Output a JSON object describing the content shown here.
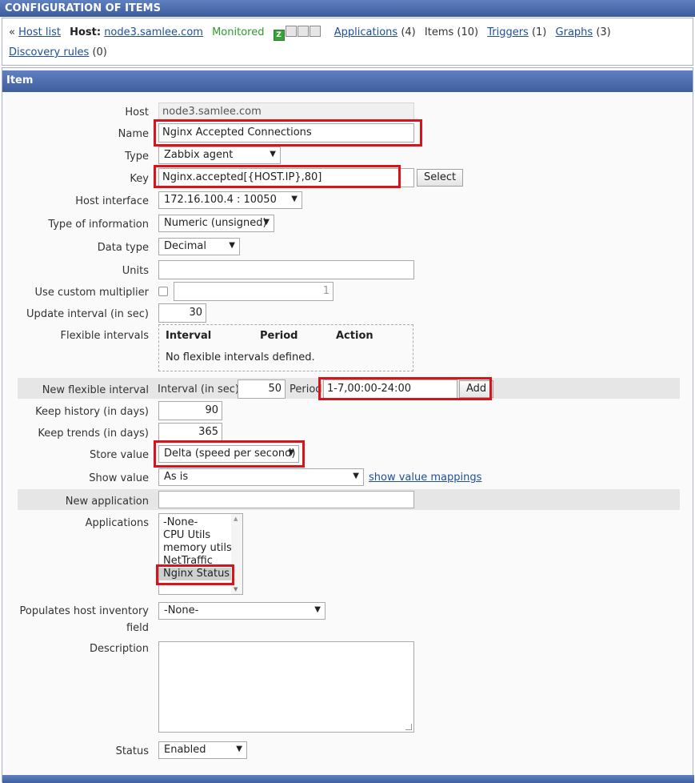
{
  "page_title": "CONFIGURATION OF ITEMS",
  "hostnav": {
    "back_mark": "«",
    "host_list": "Host list",
    "host_label": "Host:",
    "host_name": "node3.samlee.com",
    "status": "Monitored",
    "availability": [
      "Z",
      "SNMP",
      "JMX",
      "IPMI"
    ],
    "applications": "Applications",
    "applications_count": "(4)",
    "items": "Items (10)",
    "triggers": "Triggers",
    "triggers_count": "(1)",
    "graphs": "Graphs",
    "graphs_count": "(3)",
    "discovery_rules": "Discovery rules",
    "discovery_count": "(0)"
  },
  "form": {
    "header": "Item",
    "host": {
      "label": "Host",
      "value": "node3.samlee.com"
    },
    "name": {
      "label": "Name",
      "value": "Nginx Accepted Connections"
    },
    "type": {
      "label": "Type",
      "value": "Zabbix agent"
    },
    "key": {
      "label": "Key",
      "value": "Nginx.accepted[{HOST.IP},80]",
      "select_button": "Select"
    },
    "host_interface": {
      "label": "Host interface",
      "value": "172.16.100.4 : 10050"
    },
    "type_of_information": {
      "label": "Type of information",
      "value": "Numeric (unsigned)"
    },
    "data_type": {
      "label": "Data type",
      "value": "Decimal"
    },
    "units": {
      "label": "Units",
      "value": ""
    },
    "custom_multiplier": {
      "label": "Use custom multiplier",
      "checked": false,
      "value": "1"
    },
    "update_interval": {
      "label": "Update interval (in sec)",
      "value": "30"
    },
    "flexible_intervals": {
      "label": "Flexible intervals",
      "columns": [
        "Interval",
        "Period",
        "Action"
      ],
      "empty_text": "No flexible intervals defined."
    },
    "new_flexible_interval": {
      "label": "New flexible interval",
      "interval_label": "Interval (in sec)",
      "interval_value": "50",
      "period_label": "Period",
      "period_value": "1-7,00:00-24:00",
      "add_button": "Add"
    },
    "keep_history": {
      "label": "Keep history (in days)",
      "value": "90"
    },
    "keep_trends": {
      "label": "Keep trends (in days)",
      "value": "365"
    },
    "store_value": {
      "label": "Store value",
      "value": "Delta (speed per second)"
    },
    "show_value": {
      "label": "Show value",
      "value": "As is",
      "link": "show value mappings"
    },
    "new_application": {
      "label": "New application",
      "value": ""
    },
    "applications": {
      "label": "Applications",
      "options": [
        "-None-",
        "CPU Utils",
        "memory utils",
        "NetTraffic",
        "Nginx Status"
      ],
      "selected": "Nginx Status"
    },
    "inventory_field": {
      "label_line1": "Populates host inventory",
      "label_line2": "field",
      "value": "-None-"
    },
    "description": {
      "label": "Description",
      "value": ""
    },
    "status": {
      "label": "Status",
      "value": "Enabled"
    }
  },
  "colors": {
    "highlight": "#d7141a",
    "header": "#4a6aab",
    "link": "#1f4e9a",
    "monitored": "#2e9b2e"
  }
}
